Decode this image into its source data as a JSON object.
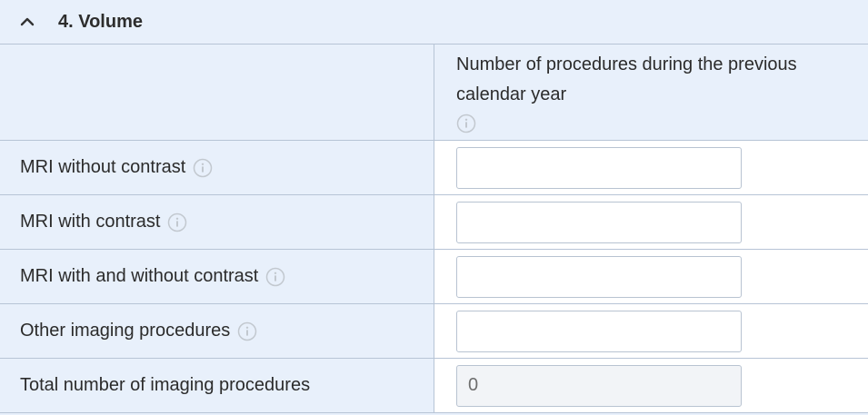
{
  "section": {
    "title": "4. Volume",
    "collapse_icon": "chevron-up-icon"
  },
  "table": {
    "column_header": "Number of procedures during the previous calendar year",
    "rows": [
      {
        "label": "MRI without contrast",
        "value": "",
        "has_info": true
      },
      {
        "label": "MRI with contrast",
        "value": "",
        "has_info": true
      },
      {
        "label": "MRI with and without contrast",
        "value": "",
        "has_info": true
      },
      {
        "label": "Other imaging procedures",
        "value": "",
        "has_info": true
      },
      {
        "label": "Total number of imaging procedures",
        "value": "0",
        "has_info": false
      }
    ]
  },
  "colors": {
    "panel_bg": "#e8f0fb",
    "border": "#b7c4d6",
    "info_icon": "#c2c8cf"
  }
}
